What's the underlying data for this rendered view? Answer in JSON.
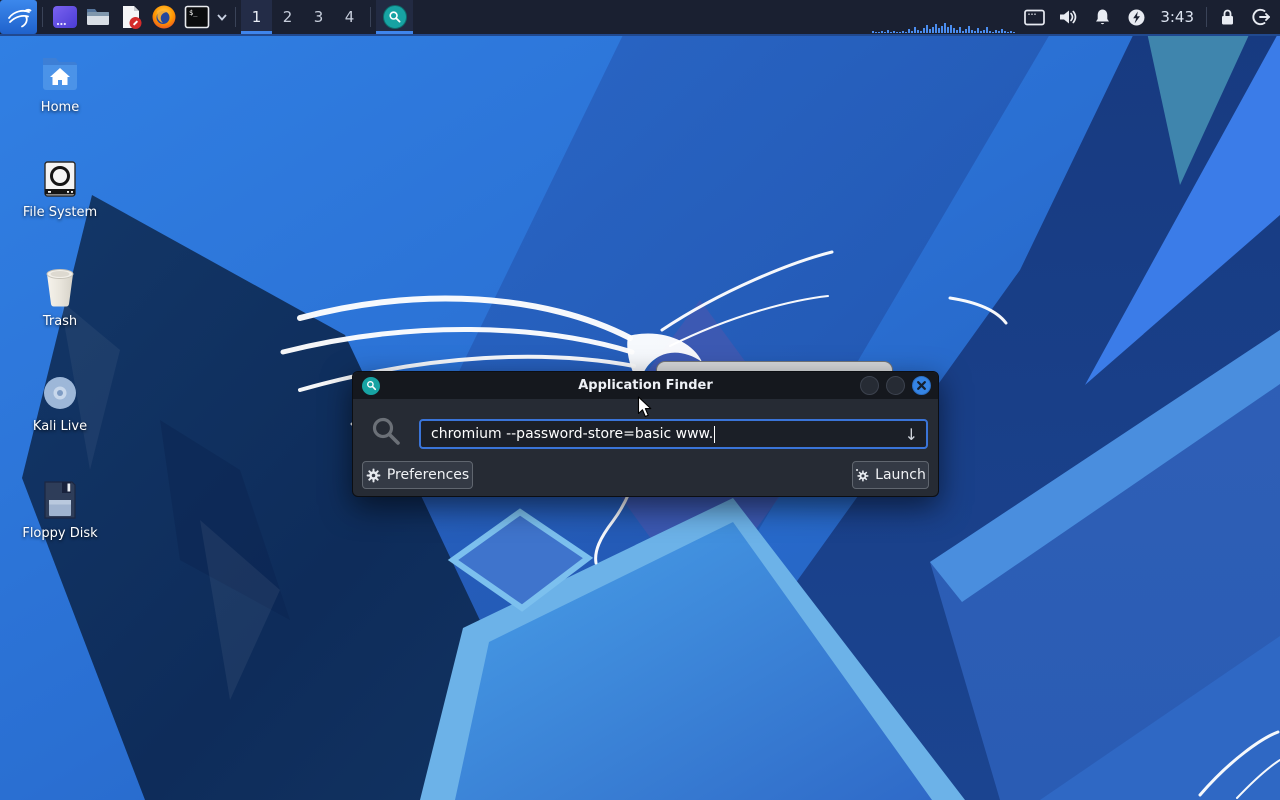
{
  "panel": {
    "workspaces": [
      "1",
      "2",
      "3",
      "4"
    ],
    "active_workspace": "1",
    "clock": "3:43",
    "launcher_icons": [
      "kali-menu",
      "desktop",
      "file-manager",
      "text-editor",
      "firefox-browser",
      "terminal"
    ],
    "taskbar_items": [
      {
        "name": "application-finder",
        "icon": "magnifier"
      }
    ],
    "cpu_graph_bars": [
      2,
      1,
      1,
      2,
      1,
      3,
      1,
      2,
      1,
      1,
      2,
      1,
      4,
      2,
      6,
      3,
      2,
      5,
      8,
      4,
      6,
      9,
      5,
      7,
      10,
      6,
      8,
      5,
      3,
      6,
      2,
      4,
      7,
      3,
      2,
      5,
      2,
      3,
      6,
      2,
      1,
      3,
      2,
      4,
      2,
      1,
      2,
      1
    ]
  },
  "desktop": {
    "icons": [
      {
        "label": "Home"
      },
      {
        "label": "File System"
      },
      {
        "label": "Trash"
      },
      {
        "label": "Kali Live"
      },
      {
        "label": "Floppy Disk"
      }
    ]
  },
  "finder_window": {
    "title": "Application Finder",
    "search_value": "chromium --password-store=basic www.",
    "drop_arrow": "↓",
    "buttons": {
      "preferences": "Preferences",
      "launch": "Launch"
    }
  },
  "colors": {
    "accent_blue": "#3f85ec",
    "panel_bg": "#1a2031",
    "window_bg": "#262b34",
    "titlebar_bg": "#15181e",
    "input_border": "#3a74d8",
    "close_button": "#3584e4",
    "finder_icon_teal": "#17a3a3"
  }
}
